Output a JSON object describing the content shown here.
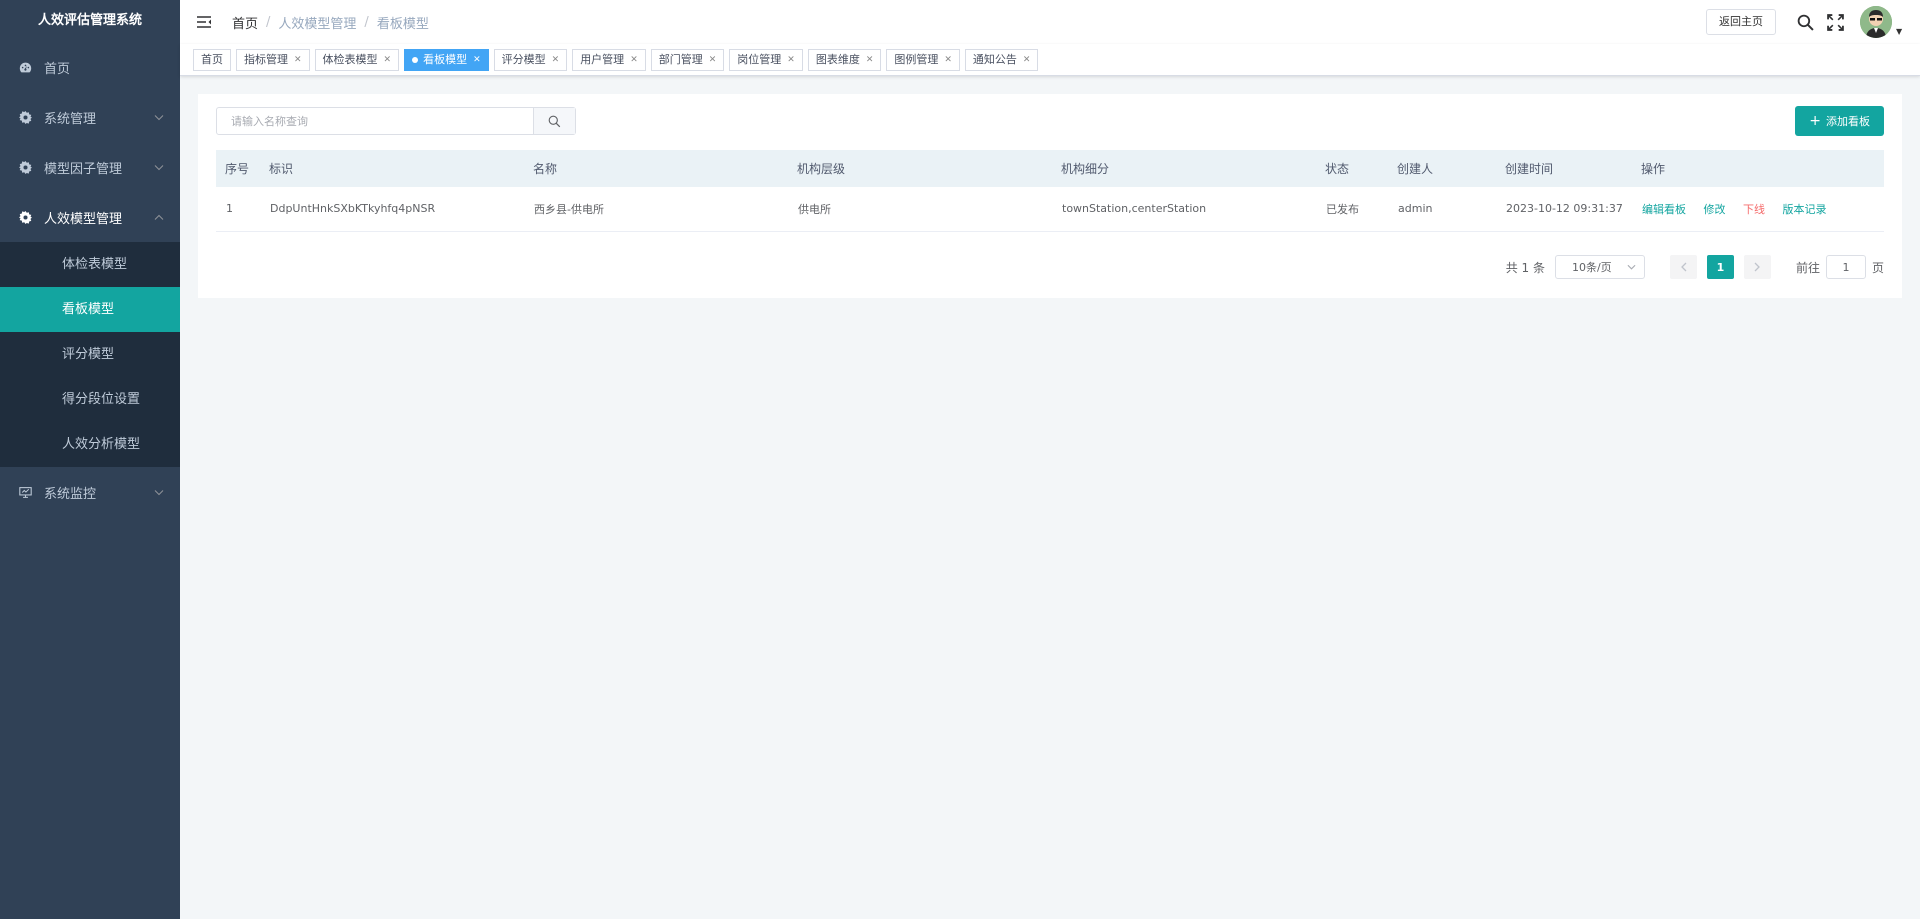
{
  "app": {
    "title": "人效评估管理系统"
  },
  "sidebar": {
    "items": [
      {
        "label": "首页",
        "icon": "dashboard-icon"
      },
      {
        "label": "系统管理",
        "icon": "gear-icon"
      },
      {
        "label": "模型因子管理",
        "icon": "gear-icon"
      },
      {
        "label": "人效模型管理",
        "icon": "gear-icon"
      },
      {
        "label": "系统监控",
        "icon": "monitor-icon"
      }
    ],
    "submenu": [
      {
        "label": "体检表模型"
      },
      {
        "label": "看板模型"
      },
      {
        "label": "评分模型"
      },
      {
        "label": "得分段位设置"
      },
      {
        "label": "人效分析模型"
      }
    ]
  },
  "breadcrumb": {
    "home": "首页",
    "level1": "人效模型管理",
    "level2": "看板模型"
  },
  "navbar": {
    "return_label": "返回主页"
  },
  "tags": [
    {
      "label": "首页"
    },
    {
      "label": "指标管理"
    },
    {
      "label": "体检表模型"
    },
    {
      "label": "看板模型"
    },
    {
      "label": "评分模型"
    },
    {
      "label": "用户管理"
    },
    {
      "label": "部门管理"
    },
    {
      "label": "岗位管理"
    },
    {
      "label": "图表维度"
    },
    {
      "label": "图例管理"
    },
    {
      "label": "通知公告"
    }
  ],
  "toolbar": {
    "search_placeholder": "请输入名称查询",
    "add_label": "添加看板"
  },
  "table": {
    "headers": [
      "序号",
      "标识",
      "名称",
      "机构层级",
      "机构细分",
      "状态",
      "创建人",
      "创建时间",
      "操作"
    ],
    "rows": [
      {
        "index": "1",
        "id": "DdpUntHnkSXbKTkyhfq4pNSR",
        "name": "西乡县-供电所",
        "level": "供电所",
        "detail": "townStation,centerStation",
        "status": "已发布",
        "creator": "admin",
        "created": "2023-10-12 09:31:37",
        "ops": {
          "edit_board": "编辑看板",
          "modify": "修改",
          "offline": "下线",
          "history": "版本记录"
        }
      }
    ]
  },
  "pagination": {
    "total": "共 1 条",
    "page_size": "10条/页",
    "current": "1",
    "goto_prefix": "前往",
    "goto_value": "1",
    "goto_suffix": "页"
  },
  "colors": {
    "accent": "#13a5a0",
    "sidebar": "#304156",
    "submenu": "#1f2d3d",
    "active_tag": "#42a5f5",
    "danger": "#f56c6c"
  }
}
